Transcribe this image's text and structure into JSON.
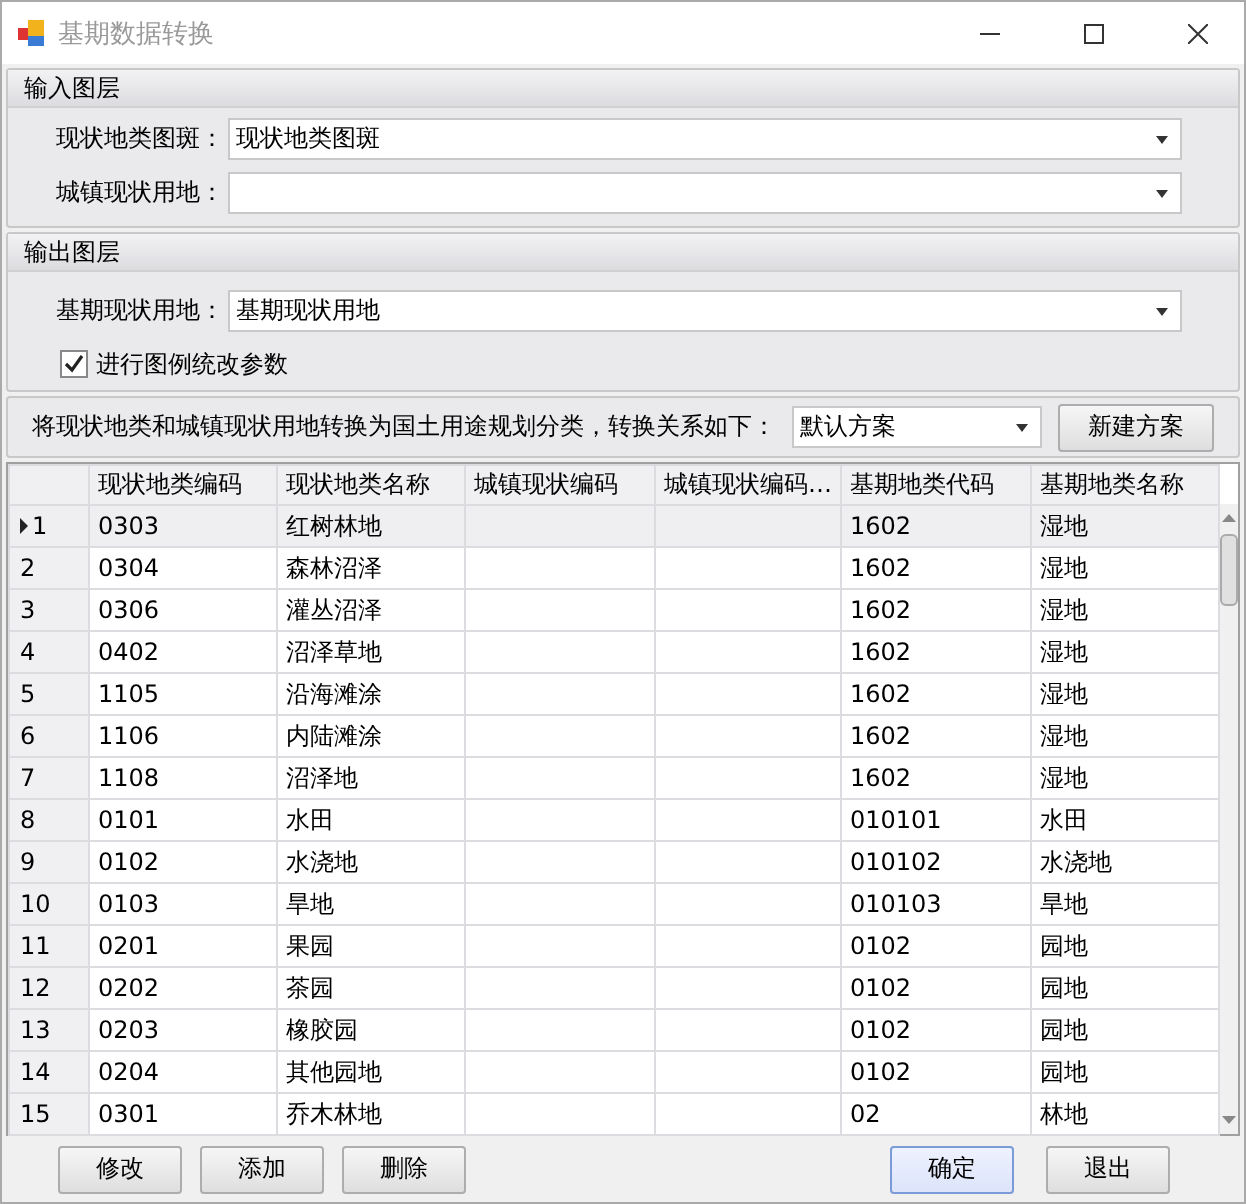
{
  "window": {
    "title": "基期数据转换"
  },
  "input_section": {
    "title": "输入图层",
    "fields": [
      {
        "label": "现状地类图斑：",
        "value": "现状地类图斑"
      },
      {
        "label": "城镇现状用地："
      }
    ]
  },
  "output_section": {
    "title": "输出图层",
    "fields": [
      {
        "label": "基期现状用地：",
        "value": "基期现状用地"
      }
    ],
    "checkbox": {
      "label": "进行图例统改参数",
      "checked": true
    }
  },
  "mapping": {
    "label": "将现状地类和城镇现状用地转换为国土用途规划分类，转换关系如下：",
    "scheme": "默认方案",
    "new_button": "新建方案"
  },
  "table": {
    "columns": [
      "现状地类编码",
      "现状地类名称",
      "城镇现状编码",
      "城镇现状编码…",
      "基期地类代码",
      "基期地类名称"
    ],
    "rows": [
      {
        "num": "1",
        "code": "0303",
        "name": "红树林地",
        "period_code": "1602",
        "period_name": "湿地",
        "selected": true
      },
      {
        "num": "2",
        "code": "0304",
        "name": "森林沼泽",
        "period_code": "1602",
        "period_name": "湿地",
        "selected": false
      },
      {
        "num": "3",
        "code": "0306",
        "name": "灌丛沼泽",
        "period_code": "1602",
        "period_name": "湿地",
        "selected": false
      },
      {
        "num": "4",
        "code": "0402",
        "name": "沼泽草地",
        "period_code": "1602",
        "period_name": "湿地",
        "selected": false
      },
      {
        "num": "5",
        "code": "1105",
        "name": "沿海滩涂",
        "period_code": "1602",
        "period_name": "湿地",
        "selected": false
      },
      {
        "num": "6",
        "code": "1106",
        "name": "内陆滩涂",
        "period_code": "1602",
        "period_name": "湿地",
        "selected": false
      },
      {
        "num": "7",
        "code": "1108",
        "name": "沼泽地",
        "period_code": "1602",
        "period_name": "湿地",
        "selected": false
      },
      {
        "num": "8",
        "code": "0101",
        "name": "水田",
        "period_code": "010101",
        "period_name": "水田",
        "selected": false
      },
      {
        "num": "9",
        "code": "0102",
        "name": "水浇地",
        "period_code": "010102",
        "period_name": "水浇地",
        "selected": false
      },
      {
        "num": "10",
        "code": "0103",
        "name": "旱地",
        "period_code": "010103",
        "period_name": "旱地",
        "selected": false
      },
      {
        "num": "11",
        "code": "0201",
        "name": "果园",
        "period_code": "0102",
        "period_name": "园地",
        "selected": false
      },
      {
        "num": "12",
        "code": "0202",
        "name": "茶园",
        "period_code": "0102",
        "period_name": "园地",
        "selected": false
      },
      {
        "num": "13",
        "code": "0203",
        "name": "橡胶园",
        "period_code": "0102",
        "period_name": "园地",
        "selected": false
      },
      {
        "num": "14",
        "code": "0204",
        "name": "其他园地",
        "period_code": "0102",
        "period_name": "园地",
        "selected": false
      },
      {
        "num": "15",
        "code": "0301",
        "name": "乔木林地",
        "period_code": "02",
        "period_name": "林地",
        "selected": false
      }
    ]
  },
  "left_buttons": [
    "修改",
    "添加",
    "删除"
  ],
  "right_buttons": [
    {
      "label": "确定",
      "default": true
    },
    {
      "label": "退出",
      "default": false
    }
  ]
}
